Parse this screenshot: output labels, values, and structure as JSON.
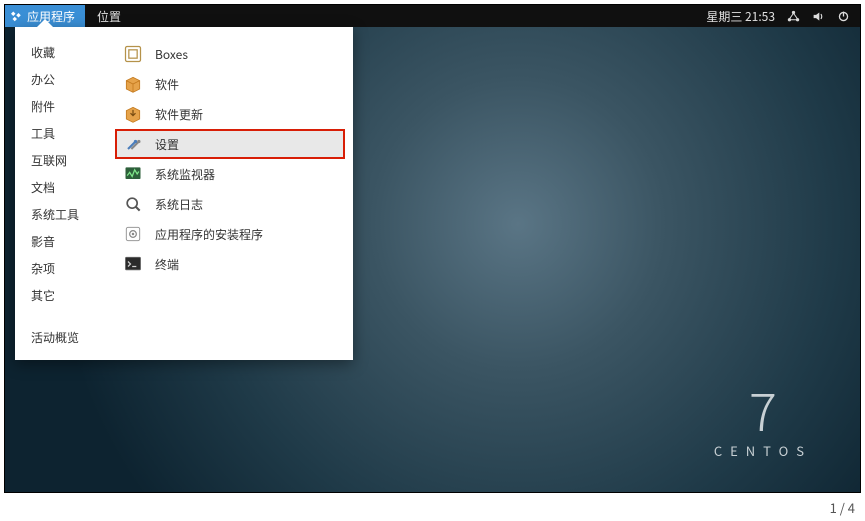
{
  "topbar": {
    "applications_label": "应用程序",
    "places_label": "位置",
    "datetime": "星期三 21:53"
  },
  "menu": {
    "categories": [
      "收藏",
      "办公",
      "附件",
      "工具",
      "互联网",
      "文档",
      "系统工具",
      "影音",
      "杂项",
      "其它"
    ],
    "activities_label": "活动概览",
    "apps": [
      {
        "label": "Boxes",
        "highlighted": false
      },
      {
        "label": "软件",
        "highlighted": false
      },
      {
        "label": "软件更新",
        "highlighted": false
      },
      {
        "label": "设置",
        "highlighted": true
      },
      {
        "label": "系统监视器",
        "highlighted": false
      },
      {
        "label": "系统日志",
        "highlighted": false
      },
      {
        "label": "应用程序的安装程序",
        "highlighted": false
      },
      {
        "label": "终端",
        "highlighted": false
      }
    ]
  },
  "branding": {
    "version": "7",
    "name": "CENTOS"
  },
  "footer": {
    "page_indicator": "1 / 4"
  }
}
